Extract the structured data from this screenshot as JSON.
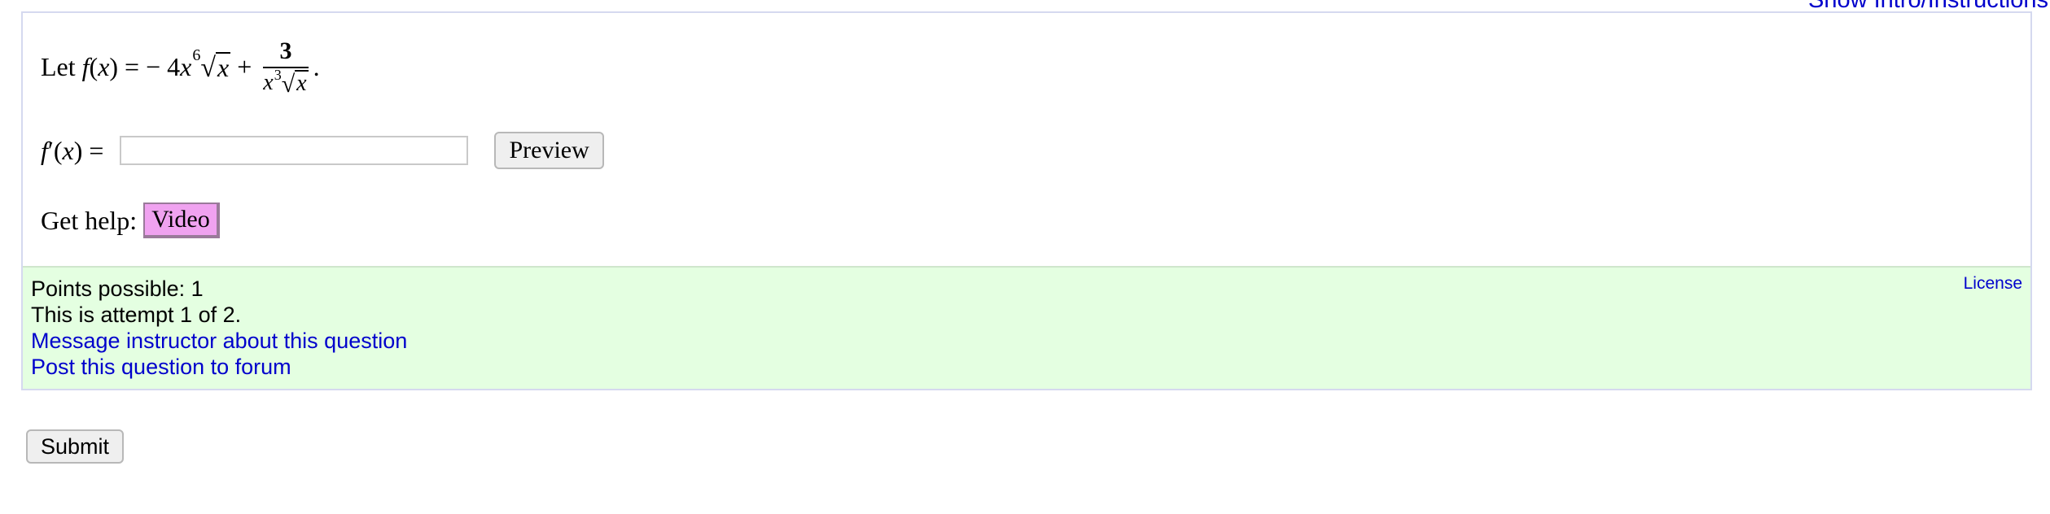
{
  "header": {
    "intro_link": "Show Intro/Instructions"
  },
  "question": {
    "prefix": "Let",
    "function_name": "f",
    "variable": "x",
    "coefficient": "− 4",
    "exponent": "6",
    "plus": "+",
    "fraction_numerator": "3",
    "denominator_exponent": "3",
    "answer_label_func": "f",
    "answer_label_prime": "′",
    "answer_value": "",
    "answer_placeholder": "",
    "preview_label": "Preview",
    "help_label": "Get help:",
    "video_label": "Video"
  },
  "info": {
    "points": "Points possible: 1",
    "attempt": "This is attempt 1 of 2.",
    "message_link": "Message instructor about this question",
    "forum_link": "Post this question to forum",
    "license_link": "License"
  },
  "submit_label": "Submit"
}
